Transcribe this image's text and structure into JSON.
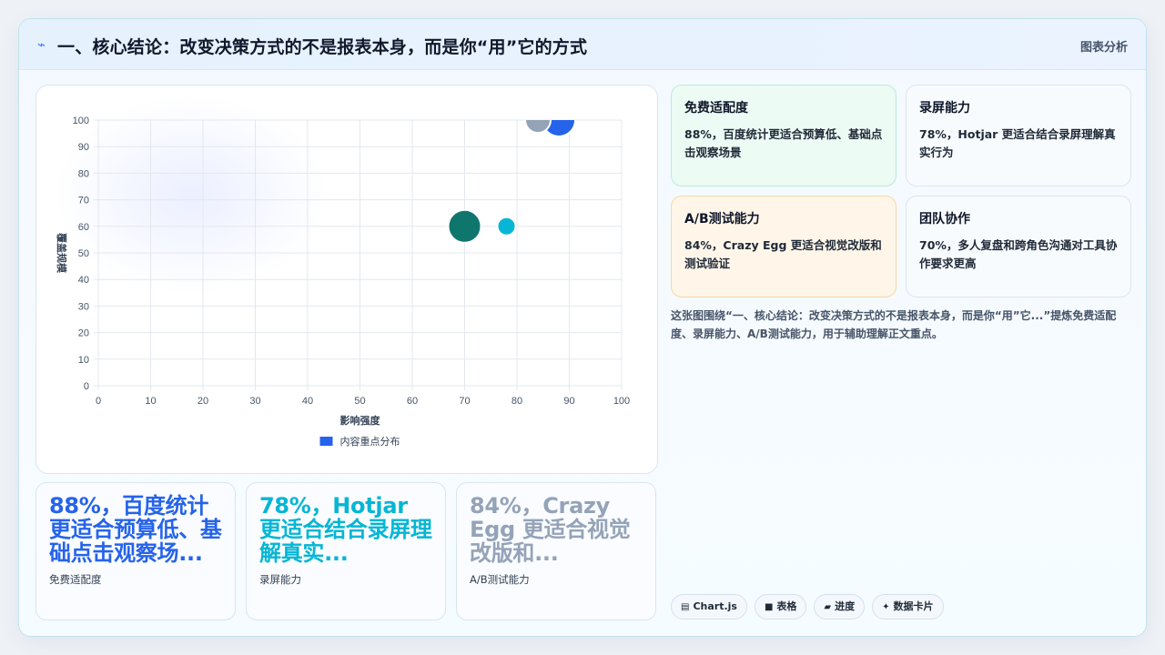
{
  "header": {
    "icon": "lightning-icon",
    "title": "一、核心结论：改变决策方式的不是报表本身，而是你“用”它的方式",
    "right_label": "图表分析"
  },
  "chart_data": {
    "type": "scatter",
    "title": "",
    "xlabel": "影响强度",
    "ylabel": "覆盖规模",
    "xlim": [
      0,
      100
    ],
    "ylim": [
      0,
      100
    ],
    "x_ticks": [
      "0",
      "10",
      "20",
      "30",
      "40",
      "50",
      "60",
      "70",
      "80",
      "90",
      "100"
    ],
    "y_ticks": [
      "0",
      "10",
      "20",
      "30",
      "40",
      "50",
      "60",
      "70",
      "80",
      "90",
      "100"
    ],
    "grid": true,
    "legend_position": "bottom",
    "series": [
      {
        "name": "内容重点分布",
        "legend_color": "#2563eb",
        "points": [
          {
            "x": 88,
            "y": 100,
            "r": 18,
            "color": "#2563eb"
          },
          {
            "x": 84,
            "y": 100,
            "r": 14,
            "color": "#94a3b8"
          },
          {
            "x": 70,
            "y": 60,
            "r": 18,
            "color": "#0f766e"
          },
          {
            "x": 78,
            "y": 60,
            "r": 10,
            "color": "#06b6d4"
          }
        ]
      }
    ]
  },
  "cards": [
    {
      "title": "免费适配度",
      "desc": "88%，百度统计更适合预算低、基础点击观察场景"
    },
    {
      "title": "录屏能力",
      "desc": "78%，Hotjar 更适合结合录屏理解真实行为"
    },
    {
      "title": "A/B测试能力",
      "desc": "84%，Crazy Egg 更适合视觉改版和测试验证"
    },
    {
      "title": "团队协作",
      "desc": "70%，多人复盘和跨角色沟通对工具协作要求更高"
    }
  ],
  "summary": "这张图围绕“一、核心结论：改变决策方式的不是报表本身，而是你“用”它...”提炼免费适配度、录屏能力、A/B测试能力，用于辅助理解正文重点。",
  "stats": [
    {
      "value": "88%，百度统计更适合预算低、基础点击观察场...",
      "label": "免费适配度",
      "color": "#2563eb"
    },
    {
      "value": "78%，Hotjar 更适合结合录屏理解真实...",
      "label": "录屏能力",
      "color": "#06b6d4"
    },
    {
      "value": "84%，Crazy Egg 更适合视觉改版和...",
      "label": "A/B测试能力",
      "color": "#94a3b8"
    }
  ],
  "tags": [
    {
      "icon": "chart-icon",
      "glyph": "▤",
      "label": "Chart.js"
    },
    {
      "icon": "table-icon",
      "glyph": "■",
      "label": "表格"
    },
    {
      "icon": "progress-icon",
      "glyph": "▰",
      "label": "进度"
    },
    {
      "icon": "sparkle-icon",
      "glyph": "✦",
      "label": "数据卡片"
    }
  ]
}
